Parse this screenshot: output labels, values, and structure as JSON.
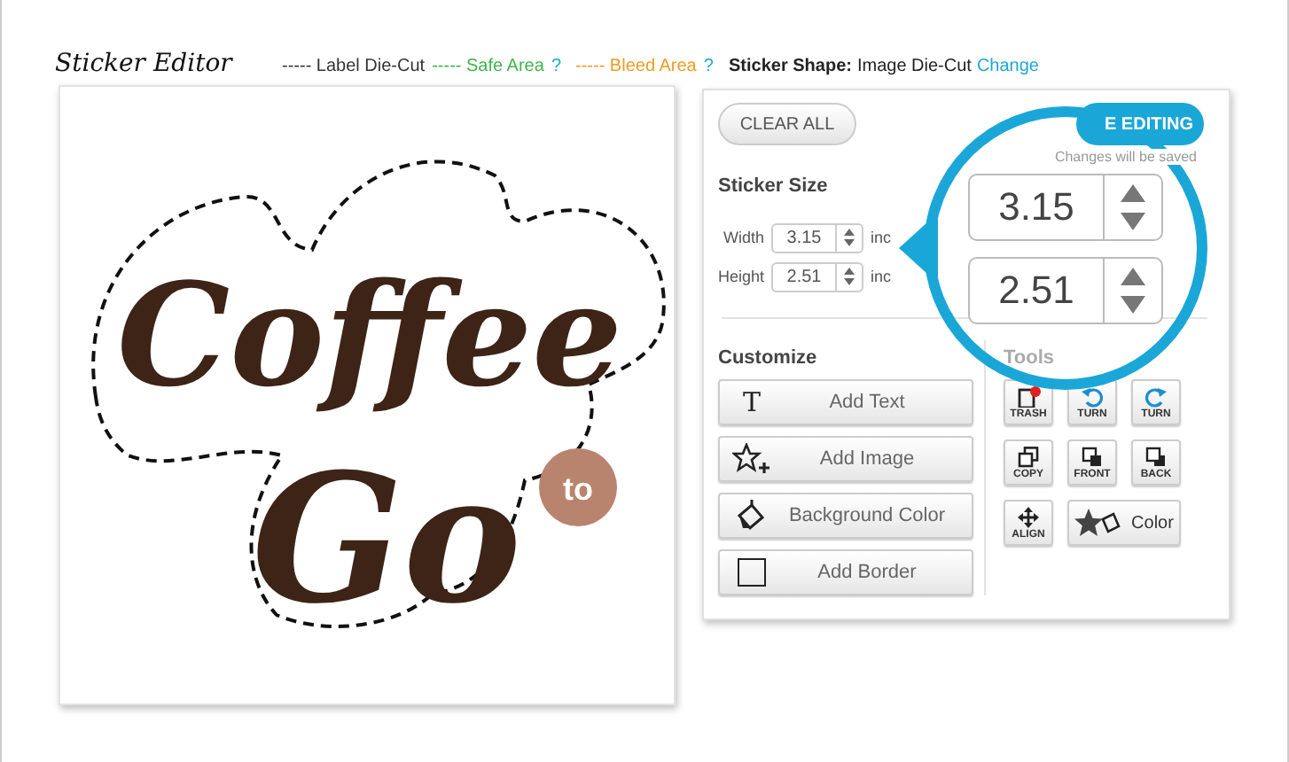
{
  "header": {
    "title": "Sticker Editor",
    "legend": [
      {
        "dash": "-----",
        "label": "Label Die-Cut",
        "color": "#333333"
      },
      {
        "dash": "-----",
        "label": "Safe Area",
        "color": "#3cb54a",
        "help": "?"
      },
      {
        "dash": "-----",
        "label": "Bleed Area",
        "color": "#f39a1e",
        "help": "?"
      }
    ],
    "shape": {
      "label": "Sticker Shape:",
      "value": "Image Die-Cut",
      "link": "Change"
    }
  },
  "canvas": {
    "logo": {
      "word_1": "Coffee",
      "badge": "to",
      "word_2": "Go"
    }
  },
  "panel": {
    "clear_button": "CLEAR ALL",
    "done_button": "E EDITING",
    "note": "Changes will be saved",
    "sticker_size": {
      "heading": "Sticker Size",
      "rows": [
        {
          "label": "Width",
          "value": "3.15",
          "unit": "inc"
        },
        {
          "label": "Height",
          "value": "2.51",
          "unit": "inc"
        }
      ]
    },
    "customize": {
      "heading": "Customize",
      "buttons": [
        {
          "kind": "text",
          "glyph": "T",
          "label": "Add Text"
        },
        {
          "kind": "image",
          "label": "Add Image"
        },
        {
          "kind": "fill",
          "label": "Background Color"
        },
        {
          "kind": "border",
          "label": "Add Border"
        }
      ]
    },
    "tools": {
      "heading": "Tools",
      "buttons": [
        {
          "kind": "trash",
          "label": "TRASH"
        },
        {
          "kind": "turn-left",
          "label": "TURN"
        },
        {
          "kind": "turn-right",
          "label": "TURN"
        },
        {
          "kind": "copy",
          "label": "COPY"
        },
        {
          "kind": "front",
          "label": "FRONT"
        },
        {
          "kind": "back",
          "label": "BACK"
        },
        {
          "kind": "align",
          "label": "ALIGN"
        },
        {
          "kind": "color",
          "label": "Color"
        }
      ]
    },
    "magnifier": {
      "fields": [
        "3.15",
        "2.51"
      ]
    }
  }
}
